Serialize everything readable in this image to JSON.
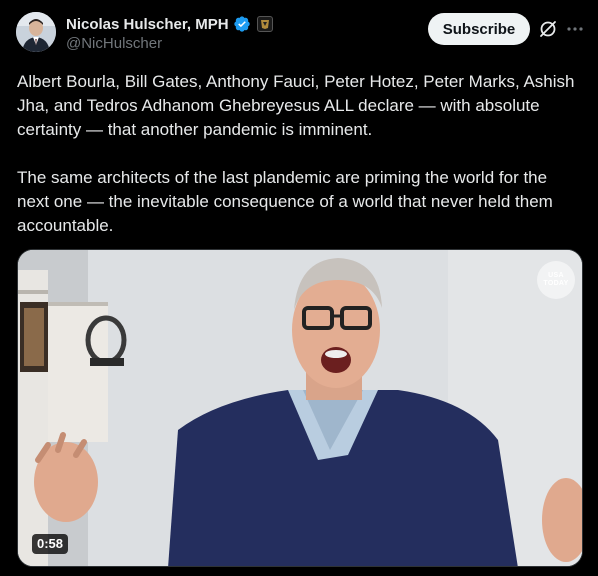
{
  "author": {
    "display_name": "Nicolas Hulscher, MPH",
    "handle": "@NicHulscher",
    "verified": true,
    "avatar_icon": "profile-photo"
  },
  "actions": {
    "subscribe_label": "Subscribe",
    "grok_icon": "grok-slash-icon",
    "more_icon": "ellipsis-icon"
  },
  "post": {
    "paragraphs": [
      "Albert Bourla, Bill Gates, Anthony Fauci, Peter Hotez, Peter Marks, Ashish Jha, and Tedros Adhanom Ghebreyesus ALL declare — with absolute certainty — that another pandemic is imminent.",
      "The same architects of the last plandemic are priming the world for the next one — the inevitable consequence of a world that never held them accountable."
    ]
  },
  "media": {
    "type": "video",
    "duration": "0:58",
    "watermark_line1": "USA",
    "watermark_line2": "TODAY"
  },
  "colors": {
    "background": "#000000",
    "text": "#e7e9ea",
    "secondary_text": "#71767b",
    "verified_badge": "#1d9bf0",
    "subscribe_bg": "#eff3f4"
  }
}
